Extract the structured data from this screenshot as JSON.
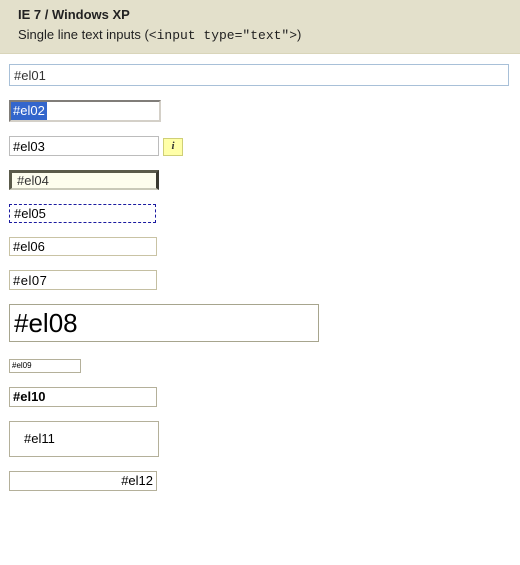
{
  "header": {
    "title": "IE 7 / Windows XP",
    "subtitle_prefix": "Single line text inputs (",
    "subtitle_code": "<input type=\"text\">",
    "subtitle_suffix": ")"
  },
  "inputs": {
    "el01": "#el01",
    "el02": "#el02",
    "el03": "#el03",
    "el03_tip": "i",
    "el04": "#el04",
    "el05": "#el05",
    "el06": "#el06",
    "el07": "#el07",
    "el08": "#el08",
    "el09": "#el09",
    "el10": "#el10",
    "el11": "#el11",
    "el12": "#el12"
  }
}
